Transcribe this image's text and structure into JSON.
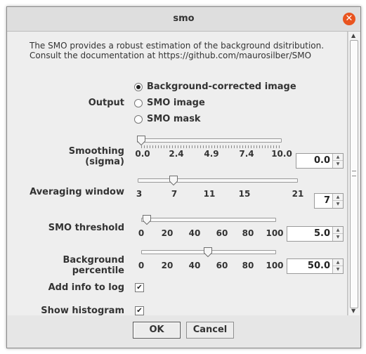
{
  "window": {
    "title": "smo"
  },
  "description": {
    "line1": "The SMO provides a robust estimation of the background dsitribution.",
    "line2": "Consult the documentation at https://github.com/maurosilber/SMO"
  },
  "output": {
    "label": "Output",
    "options": [
      {
        "label": "Background-corrected image",
        "selected": true
      },
      {
        "label": "SMO image",
        "selected": false
      },
      {
        "label": "SMO mask",
        "selected": false
      }
    ]
  },
  "smoothing": {
    "label": "Smoothing (sigma)",
    "ticks": [
      "0.0",
      "2.4",
      "4.9",
      "7.4",
      "10.0"
    ],
    "value": "0.0"
  },
  "averaging": {
    "label": "Averaging window",
    "ticks": [
      "3",
      "7",
      "11",
      "15",
      "21"
    ],
    "value": "7"
  },
  "threshold": {
    "label": "SMO threshold",
    "ticks": [
      "0",
      "20",
      "40",
      "60",
      "80",
      "100"
    ],
    "value": "5.0"
  },
  "percentile": {
    "label": "Background percentile",
    "ticks": [
      "0",
      "20",
      "40",
      "60",
      "80",
      "100"
    ],
    "value": "50.0"
  },
  "add_info": {
    "label": "Add info to log",
    "checked": true,
    "mark": "✔"
  },
  "show_histogram": {
    "label": "Show histogram",
    "checked": true,
    "mark": "✔"
  },
  "buttons": {
    "ok": "OK",
    "cancel": "Cancel"
  },
  "icons": {
    "close": "close-icon",
    "spin_up": "chevron-up-icon",
    "spin_down": "chevron-down-icon"
  }
}
